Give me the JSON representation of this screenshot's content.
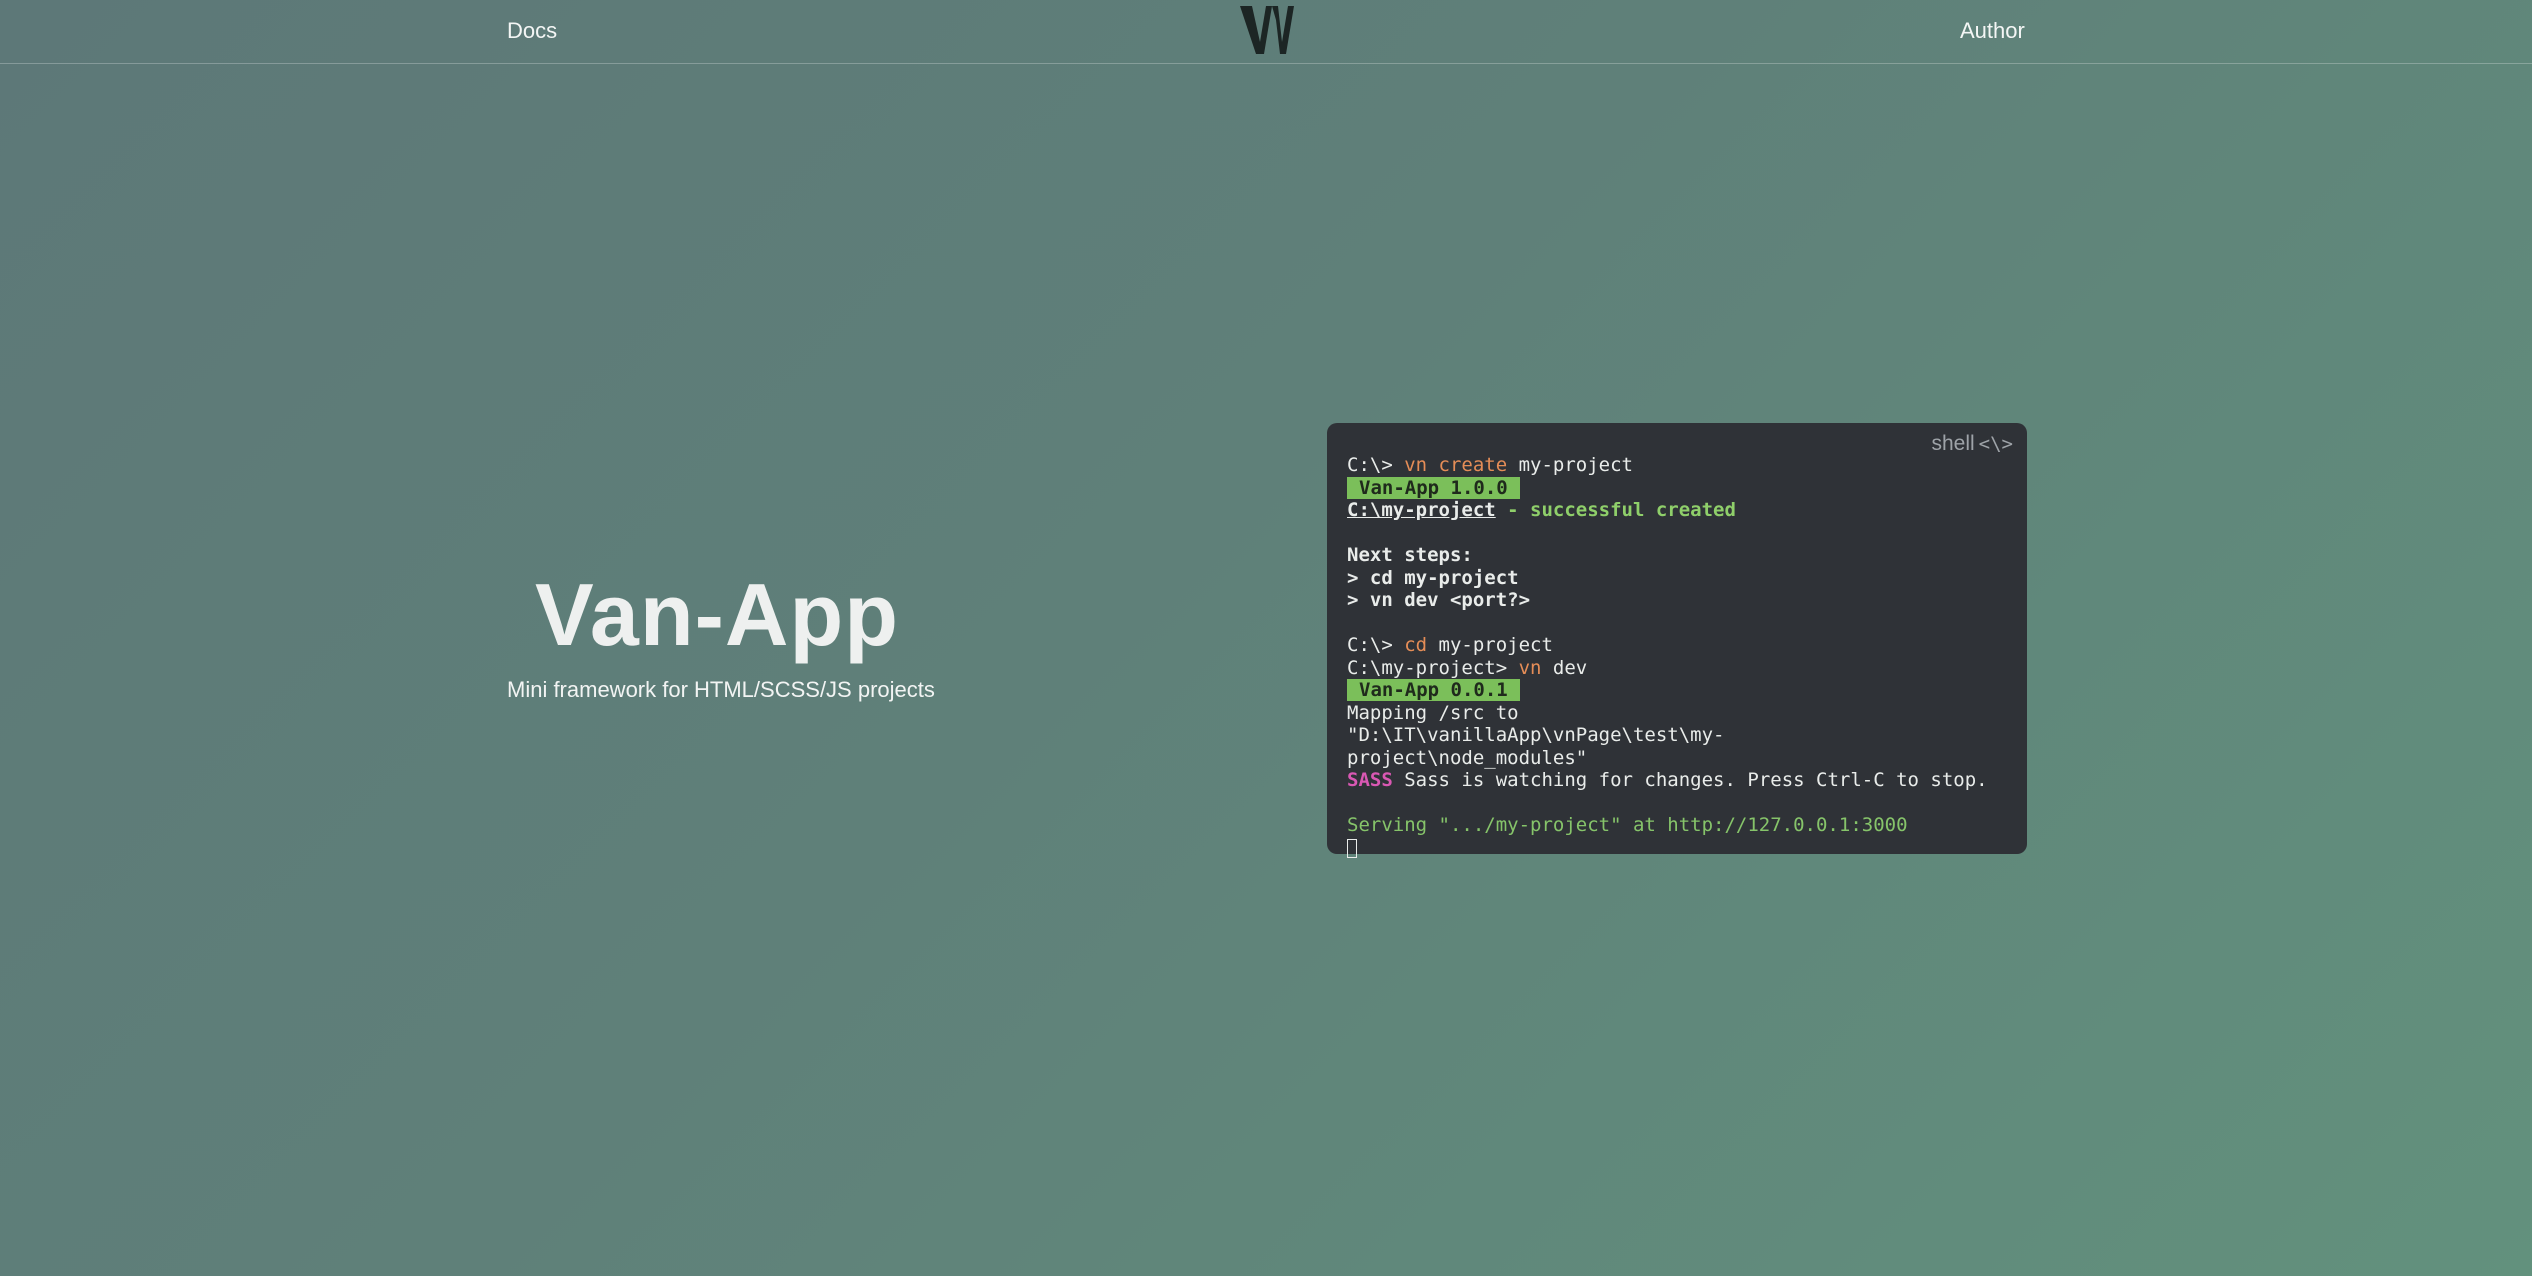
{
  "nav": {
    "docs": "Docs",
    "author": "Author",
    "logo_icon": "vn-logo-icon"
  },
  "hero": {
    "title": "Van-App",
    "subtitle": "Mini framework for HTML/SCSS/JS projects"
  },
  "terminal": {
    "label": "shell",
    "label_icon": "<\\>",
    "lines": {
      "l1_prompt": "C:\\> ",
      "l1_cmd": "vn create",
      "l1_arg": " my-project",
      "l2_badge": "Van-App 1.0.0",
      "l3_path": "C:\\my-project",
      "l3_msg": " - successful created",
      "l5": "Next steps:",
      "l6": "> cd my-project",
      "l7": "> vn dev <port?>",
      "l9_prompt": "C:\\> ",
      "l9_cmd": "cd",
      "l9_arg": " my-project",
      "l10_prompt": "C:\\my-project> ",
      "l10_cmd": "vn",
      "l10_arg": " dev",
      "l11_badge": "Van-App 0.0.1",
      "l12": "Mapping /src to \"D:\\IT\\vanillaApp\\vnPage\\test\\my-project\\node_modules\"",
      "l13_tag": "SASS",
      "l13_msg": " Sass is watching for changes. Press Ctrl-C to stop.",
      "l15": "Serving \".../my-project\" at http://127.0.0.1:3000"
    }
  },
  "colors": {
    "terminal_bg": "#2f3237",
    "badge": "#7bbf5a",
    "command": "#e58d57",
    "sass": "#d958b3",
    "serve": "#86c46a"
  }
}
